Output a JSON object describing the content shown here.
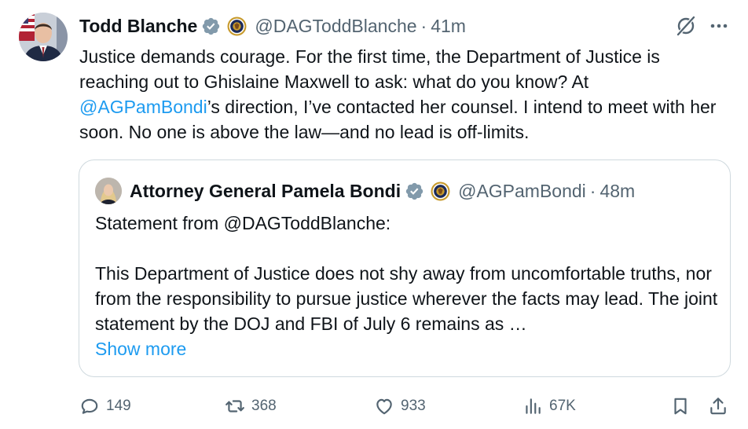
{
  "author": {
    "name": "Todd Blanche",
    "handle": "@DAGToddBlanche",
    "time": "41m",
    "avatar_icon": "user-avatar-todd-blanche",
    "verified_icon": "verified-badge-icon",
    "affiliate_icon": "doj-seal-icon"
  },
  "post": {
    "text_part1": "Justice demands courage. For the first time, the Department of Justice is reaching out to Ghislaine Maxwell to ask: what do you know? At ",
    "mention": "@AGPamBondi",
    "text_part2": "’s direction, I’ve contacted her counsel. I intend to meet with her soon. No one is above the law—and no lead is off-limits."
  },
  "quoted": {
    "name": "Attorney General Pamela Bondi",
    "handle": "@AGPamBondi",
    "time": "48m",
    "line1": "Statement from @DAGToddBlanche:",
    "paragraph": "This Department of Justice does not shy away from uncomfortable truths, nor from the responsibility to pursue justice wherever the facts may lead.  The joint statement by the DOJ and FBI of July 6 remains as …",
    "show_more": "Show more"
  },
  "separator": "·",
  "actions": {
    "replies": "149",
    "reposts": "368",
    "likes": "933",
    "views": "67K"
  },
  "colors": {
    "accent": "#1d9bf0",
    "secondary_text": "#536471",
    "border": "#cfd9de",
    "verified": "#829aab"
  }
}
